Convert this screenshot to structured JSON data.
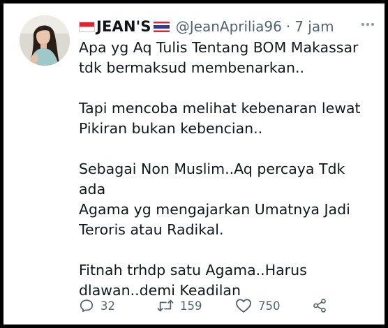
{
  "tweet": {
    "display_name": "JEAN'S",
    "handle": "@JeanAprilia96",
    "separator": "·",
    "time": "7 jam",
    "paragraphs": [
      {
        "lines": [
          "Apa yg Aq Tulis Tentang BOM Makassar",
          "tdk bermaksud membenarkan.."
        ]
      },
      {
        "lines": [
          "Tapi mencoba melihat kebenaran lewat",
          "Pikiran bukan kebencian.."
        ]
      },
      {
        "lines": [
          "Sebagai Non Muslim..Aq percaya Tdk ada",
          "Agama yg mengajarkan Umatnya Jadi",
          "Teroris atau Radikal."
        ]
      },
      {
        "lines": [
          "Fitnah trhdp satu Agama..Harus",
          "dlawan..demi Keadilan"
        ]
      }
    ],
    "counts": {
      "replies": "32",
      "retweets": "159",
      "likes": "750"
    }
  },
  "icons": {
    "reply": "reply-icon",
    "retweet": "retweet-icon",
    "like": "heart-icon",
    "share": "share-icon",
    "menu": "more-icon"
  },
  "colors": {
    "text": "#14171a",
    "secondary": "#536471",
    "flag_red": "#e0242f",
    "flag_blue": "#2f3b8f"
  }
}
